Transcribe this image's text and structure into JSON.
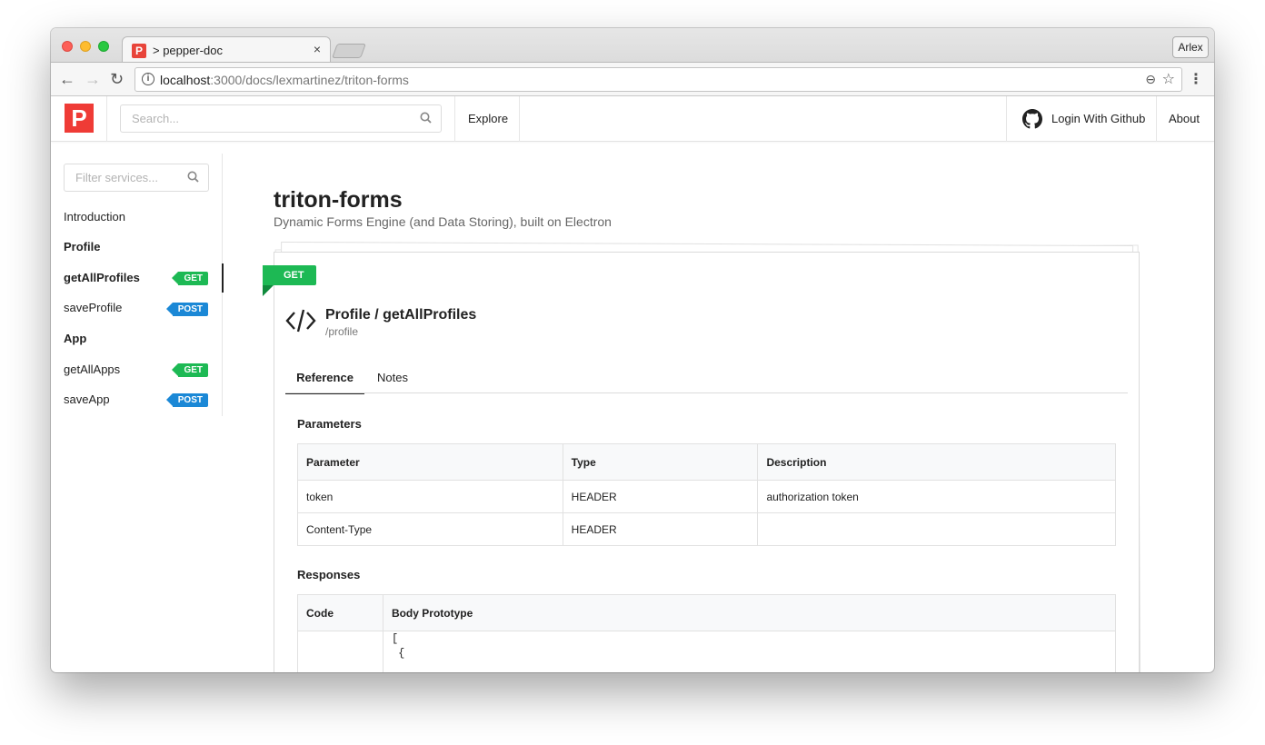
{
  "browser": {
    "tab_title": "> pepper-doc",
    "tab_favicon": "P",
    "tab_close": "×",
    "profile_name": "Arlex",
    "url_host": "localhost",
    "url_rest": ":3000/docs/lexmartinez/triton-forms",
    "back": "←",
    "forward": "→",
    "reload": "↻",
    "menu": "⋮",
    "zoom": "⊖",
    "star": "☆"
  },
  "header": {
    "logo": "P",
    "search_placeholder": "Search...",
    "explore": "Explore",
    "login": "Login With Github",
    "about": "About"
  },
  "sidebar": {
    "filter_placeholder": "Filter services...",
    "items": [
      {
        "label": "Introduction",
        "bold": false
      },
      {
        "label": "Profile",
        "bold": true
      },
      {
        "label": "getAllProfiles",
        "bold": true,
        "badge": "GET"
      },
      {
        "label": "saveProfile",
        "bold": false,
        "badge": "POST"
      },
      {
        "label": "App",
        "bold": true
      },
      {
        "label": "getAllApps",
        "bold": false,
        "badge": "GET"
      },
      {
        "label": "saveApp",
        "bold": false,
        "badge": "POST"
      }
    ]
  },
  "doc": {
    "title": "triton-forms",
    "subtitle": "Dynamic Forms Engine (and Data Storing), built on Electron"
  },
  "endpoint": {
    "method": "GET",
    "title": "Profile / getAllProfiles",
    "path": "/profile",
    "tabs": [
      "Reference",
      "Notes"
    ],
    "parameters_heading": "Parameters",
    "parameters_columns": [
      "Parameter",
      "Type",
      "Description"
    ],
    "parameters_rows": [
      [
        "token",
        "HEADER",
        "authorization token"
      ],
      [
        "Content-Type",
        "HEADER",
        ""
      ]
    ],
    "responses_heading": "Responses",
    "responses_columns": [
      "Code",
      "Body Prototype"
    ],
    "responses_body": "[\n {"
  },
  "colors": {
    "get": "#1db954",
    "post": "#1b88d6",
    "logo": "#ef3b36"
  }
}
